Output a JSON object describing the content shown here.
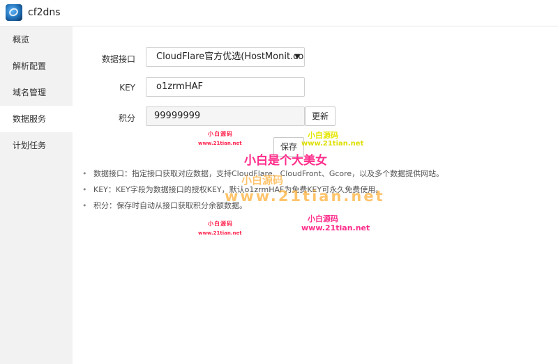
{
  "app": {
    "title": "cf2dns"
  },
  "sidebar": {
    "items": [
      {
        "label": "概览"
      },
      {
        "label": "解析配置"
      },
      {
        "label": "域名管理"
      },
      {
        "label": "数据服务"
      },
      {
        "label": "计划任务"
      }
    ]
  },
  "form": {
    "api_label": "数据接口",
    "api_value": "CloudFlare官方优选(HostMonit.co",
    "key_label": "KEY",
    "key_value": "o1zrmHAF",
    "points_label": "积分",
    "points_value": "99999999",
    "refresh_label": "更新",
    "save_label": "保存"
  },
  "notes": [
    "数据接口：指定接口获取对应数据，支持CloudFlare、CloudFront、Gcore，以及多个数据提供网站。",
    "KEY：KEY字段为数据接口的授权KEY，默认o1zrmHAF为免费KEY可永久免费使用。",
    "积分：保存时自动从接口获取积分余额数据。"
  ],
  "watermarks": {
    "red_title": "小白源码",
    "red_url": "www.21tian.net",
    "yellow_title": "小白源码",
    "yellow_url": "www.21tian.net",
    "pink_slogan": "小白是个大美女",
    "orange_title": "小白源码",
    "orange_url": "www.21tian.net",
    "pink_title": "小白源码",
    "pink_url": "www.21tian.net"
  }
}
